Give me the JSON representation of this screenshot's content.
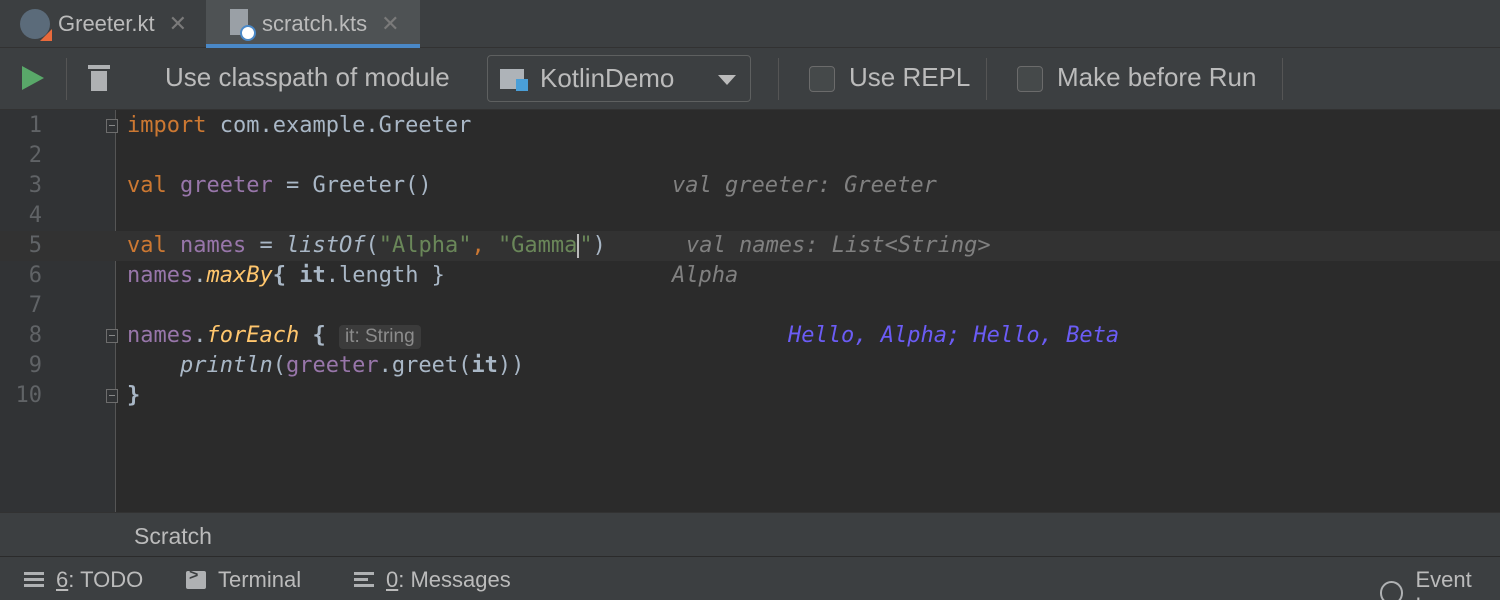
{
  "tabs": [
    {
      "label": "Greeter.kt",
      "active": false
    },
    {
      "label": "scratch.kts",
      "active": true
    }
  ],
  "toolbar": {
    "classpath_label": "Use classpath of module",
    "module_value": "KotlinDemo",
    "use_repl_label": "Use REPL",
    "make_before_run_label": "Make before Run"
  },
  "editor": {
    "line_numbers": [
      "1",
      "2",
      "3",
      "4",
      "5",
      "6",
      "7",
      "8",
      "9",
      "10"
    ],
    "line1": {
      "kw": "import",
      "rest": " com.example.Greeter"
    },
    "line3": {
      "kw": "val",
      "var": "greeter",
      "rest": " = Greeter()",
      "hint": "val greeter: Greeter"
    },
    "line5": {
      "kw": "val",
      "var": "names",
      "eq": " = ",
      "fn": "listOf",
      "open": "(",
      "s1": "\"Alpha\"",
      "comma": ", ",
      "s2a": "\"Gamma",
      "s2b": "\"",
      "close": ")",
      "hint": "val names: List<String>"
    },
    "line6": {
      "var": "names",
      "dot": ".",
      "fn": "maxBy",
      "open": "{ ",
      "it": "it",
      "rest": ".length }",
      "hint": "Alpha"
    },
    "line8": {
      "var": "names",
      "dot": ".",
      "fn": "forEach",
      "open": " { ",
      "param_hint": "it: String",
      "hint": "Hello, Alpha; Hello, Beta"
    },
    "line9": {
      "indent": "    ",
      "fn": "println",
      "open": "(",
      "var": "greeter",
      "rest": ".greet(",
      "it": "it",
      "close": "))"
    },
    "line10": {
      "close": "}"
    }
  },
  "scratch": {
    "label": "Scratch"
  },
  "bottombar": {
    "todo_num": "6",
    "todo_label": ": TODO",
    "terminal_label": "Terminal",
    "messages_num": "0",
    "messages_label": ": Messages",
    "event_log_label": "Event Lo"
  },
  "icons": {
    "kotlin_file": "kotlin-file-icon",
    "scratch_file": "scratch-file-icon",
    "run": "run-icon",
    "trash": "trash-icon",
    "module": "module-folder-icon"
  },
  "colors": {
    "keyword": "#cc7832",
    "variable": "#9876aa",
    "string": "#6a8759",
    "function": "#ffc66d",
    "output": "#6b5cf5",
    "run_green": "#59a869",
    "tab_underline": "#4a88c7"
  }
}
